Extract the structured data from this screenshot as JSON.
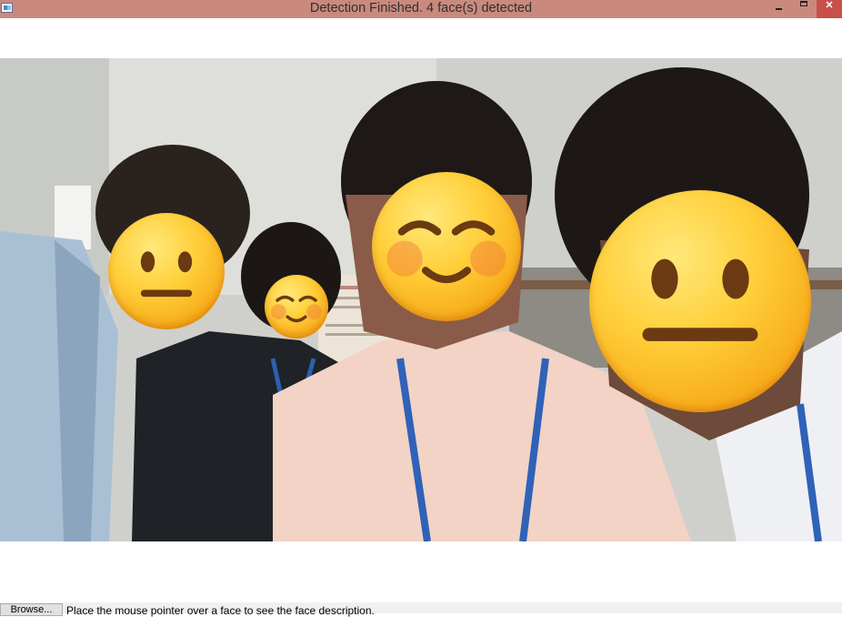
{
  "window": {
    "title": "Detection Finished. 4 face(s) detected",
    "icons": [
      "app-icon",
      "minimize-icon",
      "maximize-icon",
      "close-icon"
    ],
    "close_glyph": "✕"
  },
  "photo": {
    "faces": [
      {
        "emoji": "neutral-face"
      },
      {
        "emoji": "smiling-face"
      },
      {
        "emoji": "smiling-face"
      },
      {
        "emoji": "neutral-face"
      }
    ]
  },
  "footer": {
    "browse_button_label": "Browse...",
    "status_text": "Place the mouse pointer over a face to see the face description."
  },
  "colors": {
    "titlebar": "#c98a7d",
    "close_button": "#c7504a",
    "emoji_yellow": "#ffcf3a"
  }
}
